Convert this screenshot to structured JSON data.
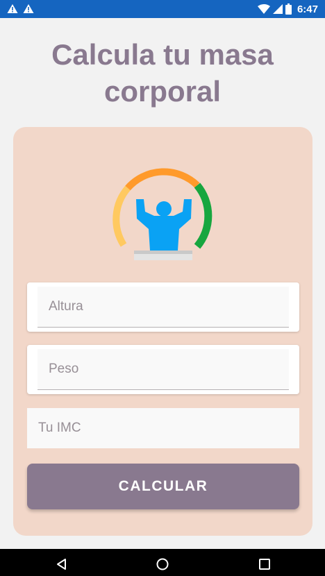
{
  "status_bar": {
    "time": "6:47",
    "left_icons": [
      "warning-icon",
      "warning-icon"
    ],
    "right_icons": [
      "wifi-icon",
      "signal-icon",
      "battery-icon"
    ],
    "color": "#1565c0"
  },
  "title": {
    "line1": "Calcula tu masa",
    "line2": "corporal"
  },
  "form": {
    "logo_icon": "bmi-gauge-strongman-icon",
    "altura_placeholder": "Altura",
    "peso_placeholder": "Peso",
    "result_text": "Tu IMC",
    "calculate_label": "CALCULAR"
  },
  "nav_bar": {
    "icons": [
      "back-icon",
      "home-icon",
      "recents-icon"
    ]
  },
  "colors": {
    "background": "#f2f2f2",
    "card": "#f2d7c9",
    "accent": "#89798f",
    "gauge_yellow": "#ffc960",
    "gauge_orange": "#ff9a2b",
    "gauge_green": "#17a63f",
    "figure_blue": "#0aa2f4"
  }
}
